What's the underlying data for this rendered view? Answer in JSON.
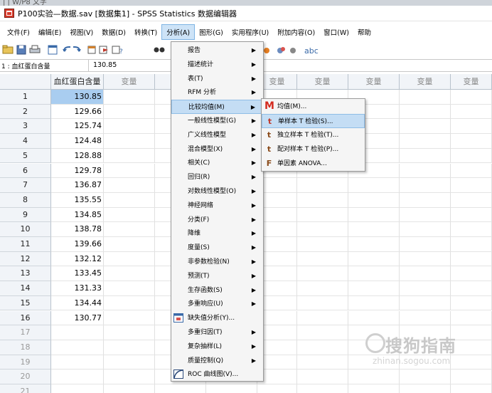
{
  "top_strip": {
    "text": "| | W/P8 文字"
  },
  "window": {
    "title": "P100实验—数据.sav [数据集1] - SPSS Statistics 数据编辑器"
  },
  "menubar": [
    {
      "label": "文件(F)",
      "w": 40
    },
    {
      "label": "编辑(E)",
      "w": 46
    },
    {
      "label": "视图(V)",
      "w": 48
    },
    {
      "label": "数据(D)",
      "w": 46
    },
    {
      "label": "转换(T)",
      "w": 46
    },
    {
      "label": "分析(A)",
      "w": 44,
      "active": true
    },
    {
      "label": "图形(G)",
      "w": 48
    },
    {
      "label": "实用程序(U)",
      "w": 64
    },
    {
      "label": "附加内容(O)",
      "w": 64
    },
    {
      "label": "窗口(W)",
      "w": 52
    },
    {
      "label": "帮助",
      "w": 30
    }
  ],
  "cell_editor": {
    "ref": "1 : 血红蛋白含量",
    "value": "130.85"
  },
  "grid": {
    "first_column_header": "血红蛋白含量",
    "var_label": "变量",
    "rows": [
      "1",
      "2",
      "3",
      "4",
      "5",
      "6",
      "7",
      "8",
      "9",
      "10",
      "11",
      "12",
      "13",
      "14",
      "15",
      "16",
      "17",
      "18",
      "19",
      "20",
      "21"
    ],
    "values": [
      "130.85",
      "129.66",
      "125.74",
      "124.48",
      "128.88",
      "129.78",
      "136.87",
      "135.55",
      "134.85",
      "138.78",
      "139.66",
      "132.12",
      "133.45",
      "131.33",
      "134.44",
      "130.77"
    ]
  },
  "analyze_menu": [
    {
      "label": "报告",
      "arrow": true
    },
    {
      "label": "描述统计",
      "arrow": true
    },
    {
      "label": "表(T)",
      "arrow": true
    },
    {
      "label": "RFM 分析",
      "arrow": true
    },
    {
      "label": "比较均值(M)",
      "arrow": true,
      "highlight": true
    },
    {
      "label": "一般线性模型(G)",
      "arrow": true
    },
    {
      "label": "广义线性模型",
      "arrow": true
    },
    {
      "label": "混合模型(X)",
      "arrow": true
    },
    {
      "label": "相关(C)",
      "arrow": true
    },
    {
      "label": "回归(R)",
      "arrow": true
    },
    {
      "label": "对数线性模型(O)",
      "arrow": true
    },
    {
      "label": "神经网络",
      "arrow": true
    },
    {
      "label": "分类(F)",
      "arrow": true
    },
    {
      "label": "降维",
      "arrow": true
    },
    {
      "label": "度量(S)",
      "arrow": true
    },
    {
      "label": "非参数检验(N)",
      "arrow": true
    },
    {
      "label": "预测(T)",
      "arrow": true
    },
    {
      "label": "生存函数(S)",
      "arrow": true
    },
    {
      "label": "多重响应(U)",
      "arrow": true
    },
    {
      "label": "缺失值分析(Y)...",
      "arrow": false,
      "icon": "missing-value-icon"
    },
    {
      "label": "多重归因(T)",
      "arrow": true
    },
    {
      "label": "复杂抽样(L)",
      "arrow": true
    },
    {
      "label": "质量控制(Q)",
      "arrow": true
    },
    {
      "label": "ROC 曲线图(V)...",
      "arrow": false,
      "icon": "roc-curve-icon"
    }
  ],
  "compare_means_menu": [
    {
      "label": "均值(M)...",
      "icon": "M",
      "icon_name": "means-icon",
      "color": "#d42a1f"
    },
    {
      "label": "单样本 T 检验(S)...",
      "icon": "t",
      "icon_name": "one-sample-t-icon",
      "color": "#c0392b",
      "highlight": true
    },
    {
      "label": "独立样本 T 检验(T)...",
      "icon": "t",
      "icon_name": "independent-t-icon",
      "color": "#8a4b1a"
    },
    {
      "label": "配对样本 T 检验(P)...",
      "icon": "t",
      "icon_name": "paired-t-icon",
      "color": "#8a4b1a"
    },
    {
      "label": "单因素 ANOVA...",
      "icon": "F",
      "icon_name": "anova-icon",
      "color": "#8a4b1a"
    }
  ],
  "watermark": {
    "brand": "搜狗指南",
    "url": "zhinan.sogou.com"
  },
  "colors": {
    "selected_cell": "#a9cdf0",
    "menu_highlight": "#c4ddf4",
    "header_bg": "#f1f4f8"
  }
}
